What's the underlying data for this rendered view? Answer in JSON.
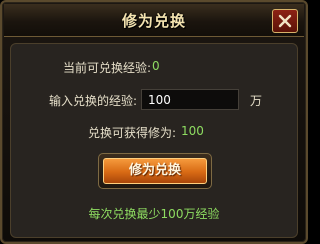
{
  "dialog": {
    "title": "修为兑换",
    "close_icon": "close-x-icon"
  },
  "current_exp": {
    "label": "当前可兑换经验:",
    "value": "0"
  },
  "input_exp": {
    "label": "输入兑换的经验:",
    "value": "100",
    "unit": "万"
  },
  "result": {
    "label": "兑换可获得修为:",
    "value": "100"
  },
  "exchange_button": {
    "label": "修为兑换"
  },
  "notice": "每次兑换最少100万经验",
  "colors": {
    "value_green": "#8edc61",
    "button_orange": "#e07a22",
    "close_red": "#8d2214",
    "border_gold": "#5b4a2d"
  }
}
